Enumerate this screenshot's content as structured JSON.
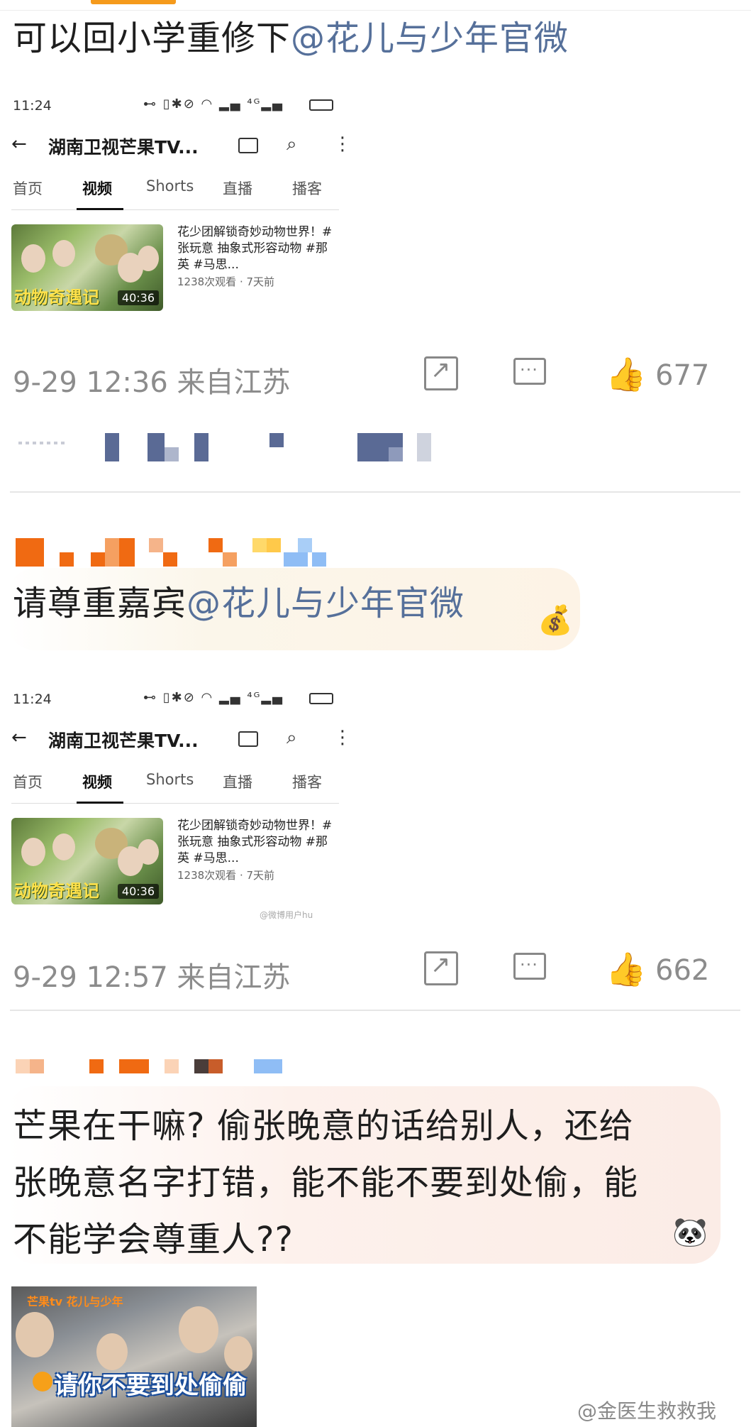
{
  "posts": [
    {
      "text": "可以回小学重修下",
      "mention": "@花儿与少年官微",
      "screenshot": {
        "status_time": "11:24",
        "status_icons": "⊷   ▯✱⊘ ◠ ▂▄ ⁴ᴳ▂▄",
        "back_icon": "←",
        "channel": "湖南卫视芒果TV...",
        "search_icon": "⌕",
        "more_icon": "⋮",
        "tabs": [
          "首页",
          "视频",
          "Shorts",
          "直播",
          "播客"
        ],
        "active_tab": "视频",
        "thumb_title": "动物奇遇记",
        "duration": "40:36",
        "video_title": "花少团解锁奇妙动物世界！#张玩意 抽象式形容动物 #那英 #马思...",
        "video_meta": "1238次观看 · 7天前",
        "watermark": ""
      },
      "time": "9-29 12:36 来自江苏",
      "likes": "677"
    },
    {
      "text": "请尊重嘉宾",
      "mention": "@花儿与少年官微",
      "screenshot": {
        "status_time": "11:24",
        "status_icons": "⊷   ▯✱⊘ ◠ ▂▄ ⁴ᴳ▂▄",
        "back_icon": "←",
        "channel": "湖南卫视芒果TV...",
        "search_icon": "⌕",
        "more_icon": "⋮",
        "tabs": [
          "首页",
          "视频",
          "Shorts",
          "直播",
          "播客"
        ],
        "active_tab": "视频",
        "thumb_title": "动物奇遇记",
        "duration": "40:36",
        "video_title": "花少团解锁奇妙动物世界！#张玩意 抽象式形容动物 #那英 #马思...",
        "video_meta": "1238次观看 · 7天前",
        "watermark": "@微博用户hu"
      },
      "time": "9-29 12:57 来自江苏",
      "likes": "662"
    },
    {
      "text_lines": [
        "芒果在干嘛? 偷张晚意的话给别人，还给",
        "张晚意名字打错，能不能不要到处偷，能",
        "不能学会尊重人??"
      ],
      "video_logo": "芒果tv 花儿与少年",
      "video_caption": "请你不要到处偷偷"
    }
  ],
  "icons": {
    "share": "share-icon",
    "comment": "comment-icon",
    "like": "thumbs-up-icon",
    "like_glyph": "👍"
  },
  "weibo_watermark": "@金医生救救我",
  "colors": {
    "mention": "#56709a",
    "meta_gray": "#8c8c8c",
    "accent_orange": "#f59a1b"
  }
}
